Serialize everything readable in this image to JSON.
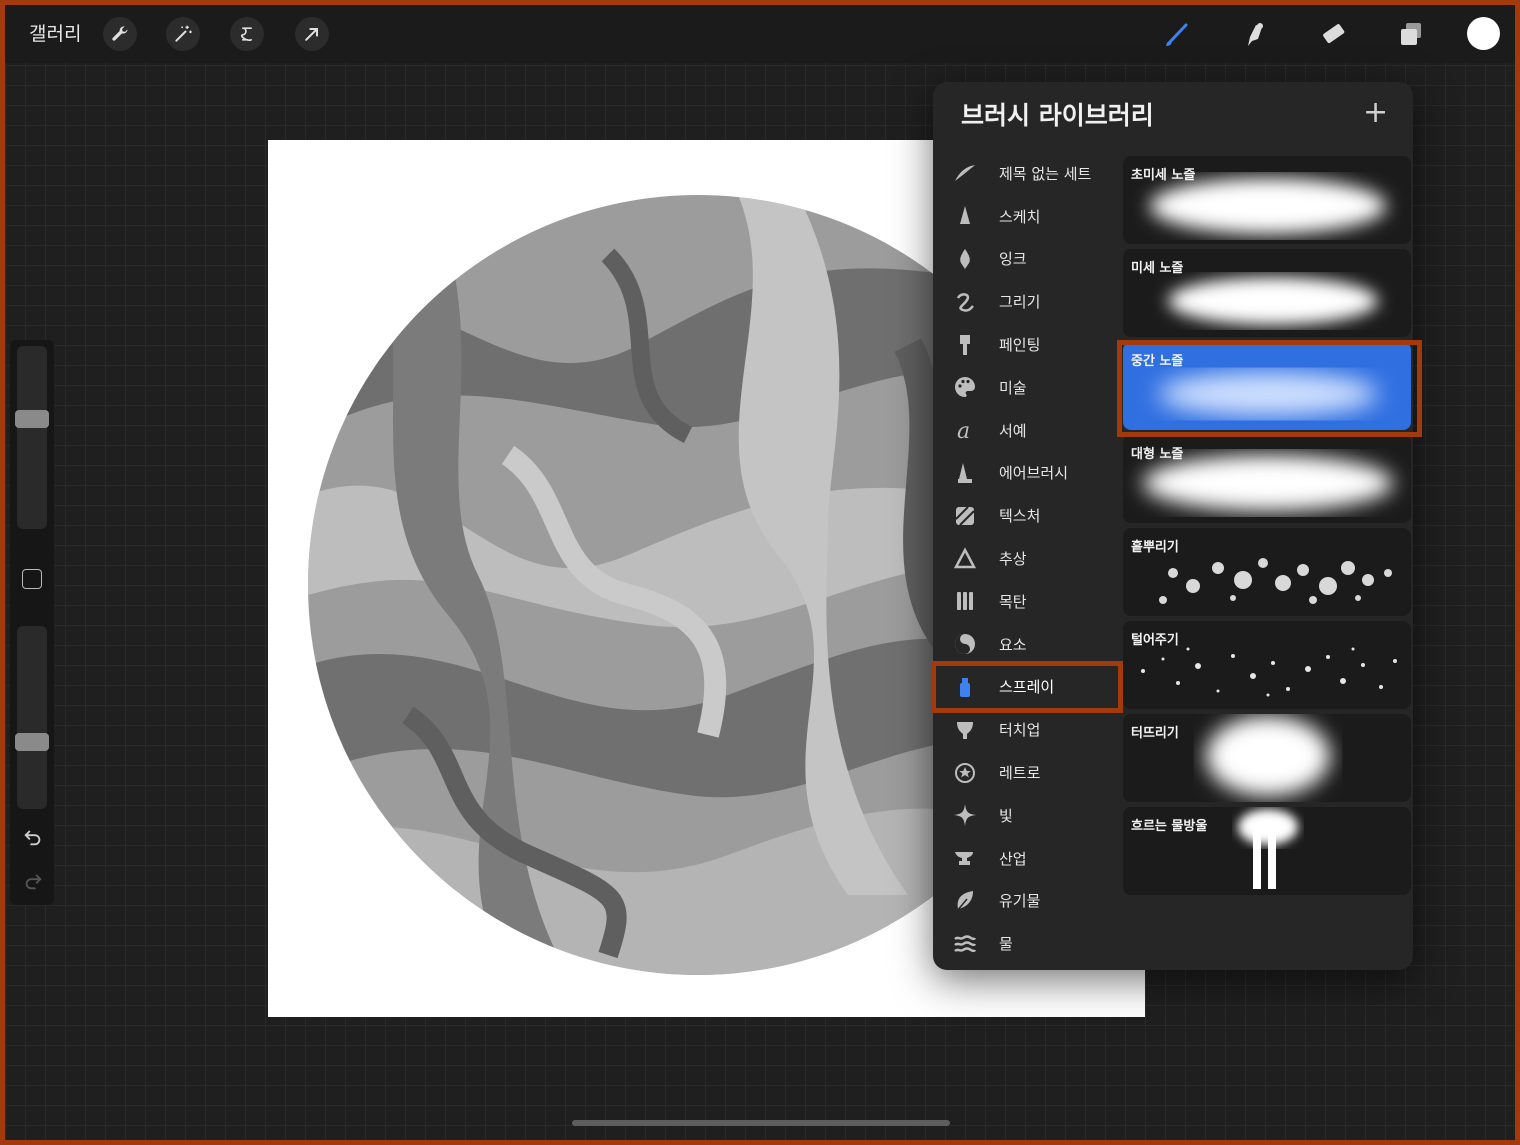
{
  "topbar": {
    "gallery_label": "갤러리",
    "actions": [
      {
        "icon": "wrench-icon"
      },
      {
        "icon": "magic-wand-icon"
      },
      {
        "icon": "selection-icon"
      },
      {
        "icon": "move-arrow-icon"
      }
    ],
    "tools": [
      {
        "icon": "brush-icon",
        "active": true
      },
      {
        "icon": "smudge-icon",
        "active": false
      },
      {
        "icon": "eraser-icon",
        "active": false
      },
      {
        "icon": "layers-icon",
        "active": false
      }
    ],
    "current_color": "#ffffff"
  },
  "sidebar": {
    "brush_size_level": 0.45,
    "opacity_level": 0.65
  },
  "brush_library": {
    "title": "브러시 라이브러리",
    "add_label": "+",
    "categories": [
      {
        "label": "제목 없는 세트",
        "icon": "untitled-set-icon"
      },
      {
        "label": "스케치",
        "icon": "sketch-icon"
      },
      {
        "label": "잉크",
        "icon": "ink-icon"
      },
      {
        "label": "그리기",
        "icon": "drawing-icon"
      },
      {
        "label": "페인팅",
        "icon": "painting-icon"
      },
      {
        "label": "미술",
        "icon": "palette-icon"
      },
      {
        "label": "서예",
        "icon": "calligraphy-icon"
      },
      {
        "label": "에어브러시",
        "icon": "airbrush-icon"
      },
      {
        "label": "텍스처",
        "icon": "texture-icon"
      },
      {
        "label": "추상",
        "icon": "abstract-icon"
      },
      {
        "label": "목탄",
        "icon": "charcoal-icon"
      },
      {
        "label": "요소",
        "icon": "elements-icon"
      },
      {
        "label": "스프레이",
        "icon": "spray-can-icon",
        "active": true
      },
      {
        "label": "터치업",
        "icon": "touchup-icon"
      },
      {
        "label": "레트로",
        "icon": "retro-icon"
      },
      {
        "label": "빛",
        "icon": "sparkle-icon"
      },
      {
        "label": "산업",
        "icon": "anvil-icon"
      },
      {
        "label": "유기물",
        "icon": "leaf-icon"
      },
      {
        "label": "물",
        "icon": "water-icon"
      }
    ],
    "brushes": [
      {
        "name": "초미세 노즐",
        "style": "soft"
      },
      {
        "name": "미세 노즐",
        "style": "soft-grain"
      },
      {
        "name": "중간 노즐",
        "style": "medium",
        "selected": true
      },
      {
        "name": "대형 노즐",
        "style": "large"
      },
      {
        "name": "흩뿌리기",
        "style": "splatter"
      },
      {
        "name": "털어주기",
        "style": "flick"
      },
      {
        "name": "터뜨리기",
        "style": "burst"
      },
      {
        "name": "흐르는 물방울",
        "style": "drip"
      }
    ],
    "accent_color": "#2f6fe0",
    "highlight_color": "#a23a0b"
  }
}
